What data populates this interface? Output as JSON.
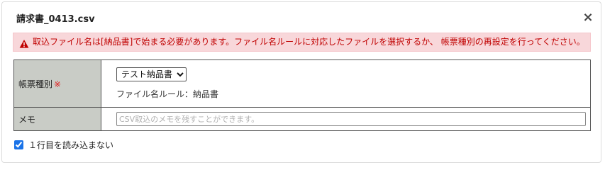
{
  "dialog": {
    "title": "請求書_0413.csv",
    "close_label": "×"
  },
  "alert": {
    "icon": "warning-triangle-icon",
    "message": "取込ファイル名は[納品書]で始まる必要があります。ファイル名ルールに対応したファイルを選択するか、 帳票種別の再設定を行ってください。",
    "color": "#c00000",
    "background": "#f8d7da"
  },
  "form": {
    "type_label": "帳票種別",
    "required_mark": "※",
    "type_select": {
      "selected": "テスト納品書"
    },
    "filename_rule": "ファイル名ルール：納品書",
    "memo_label": "メモ",
    "memo_value": "",
    "memo_placeholder": "CSV取込のメモを残すことができます。"
  },
  "options": {
    "skip_first_row_label": "１行目を読み込まない",
    "skip_first_row_checked": true
  }
}
